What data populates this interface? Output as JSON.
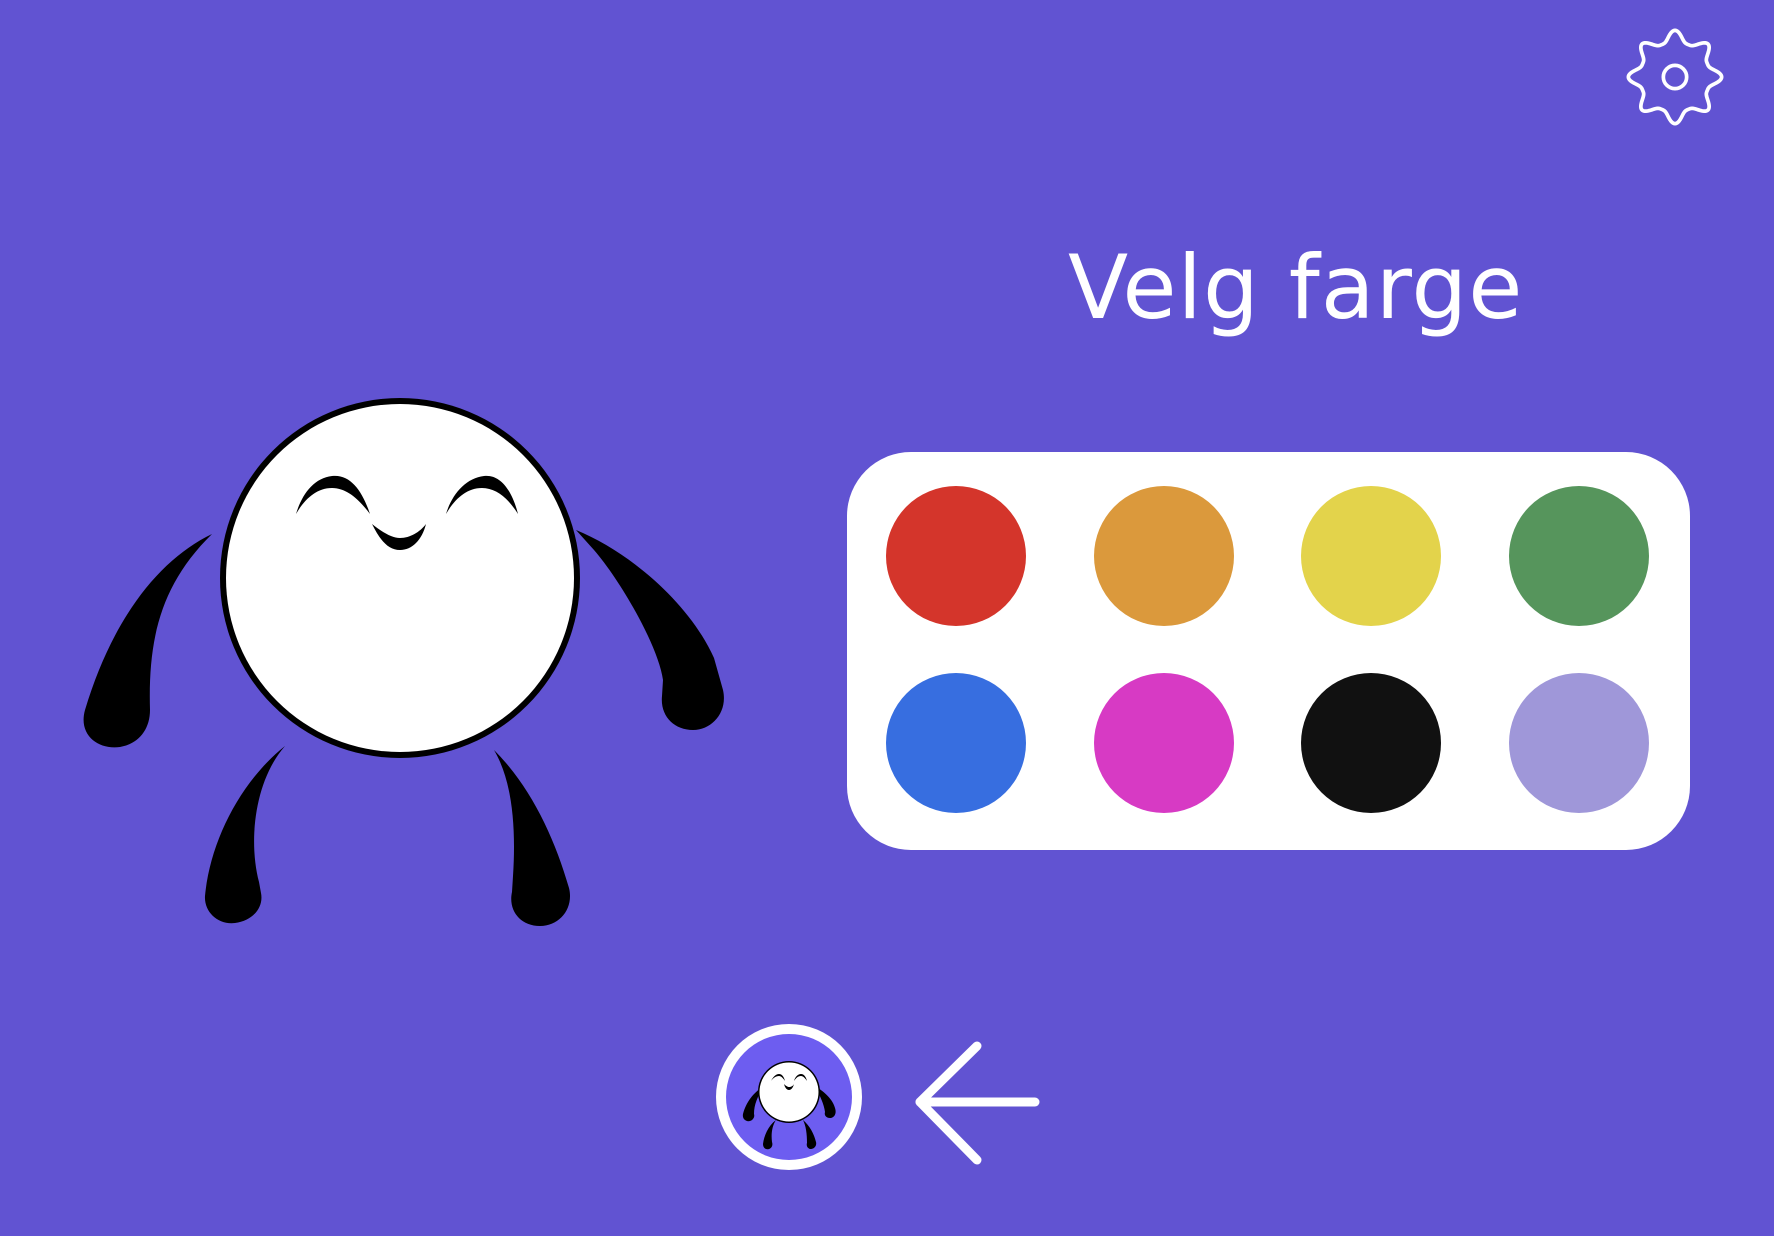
{
  "screen": {
    "background_color": "#6153d2",
    "title": "Velg farge"
  },
  "settings": {
    "icon": "gear-icon"
  },
  "character": {
    "icon": "smiling-round-creature",
    "body_color": "#ffffff"
  },
  "palette": {
    "background_color": "#ffffff",
    "swatches": [
      {
        "id": "red",
        "color": "#d4352b"
      },
      {
        "id": "orange",
        "color": "#db993c"
      },
      {
        "id": "yellow",
        "color": "#e3d34b"
      },
      {
        "id": "green",
        "color": "#56955c"
      },
      {
        "id": "blue",
        "color": "#376ee0"
      },
      {
        "id": "magenta",
        "color": "#d73ac4"
      },
      {
        "id": "black",
        "color": "#111111"
      },
      {
        "id": "lavender",
        "color": "#9f97d9"
      }
    ]
  },
  "footer": {
    "avatar_icon": "character-avatar-icon",
    "avatar_background_color": "#6d5df0",
    "back_icon": "arrow-left-icon"
  }
}
